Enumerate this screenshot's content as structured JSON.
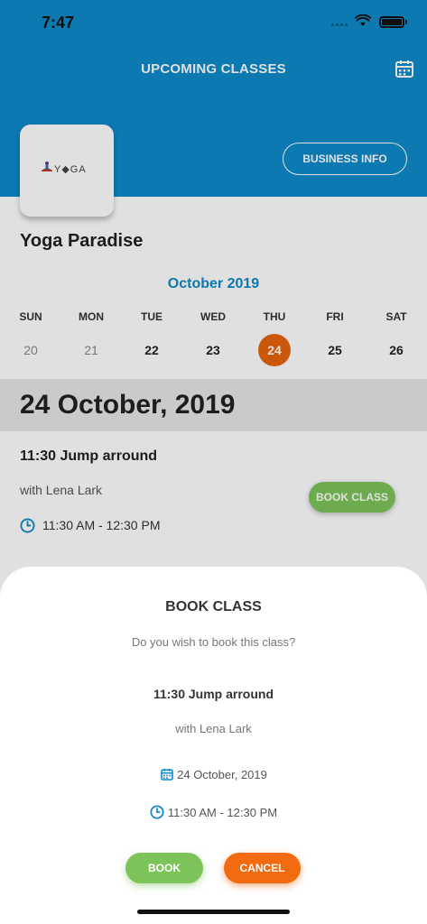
{
  "status_bar": {
    "time": "7:47"
  },
  "header": {
    "title": "UPCOMING CLASSES",
    "calendar_icon": "calendar-icon"
  },
  "business": {
    "logo_text": "Y◆GA",
    "info_button": "BUSINESS INFO",
    "name": "Yoga Paradise"
  },
  "calendar": {
    "month": "October 2019",
    "weekdays": [
      "SUN",
      "MON",
      "TUE",
      "WED",
      "THU",
      "FRI",
      "SAT"
    ],
    "days": [
      "20",
      "21",
      "22",
      "23",
      "24",
      "25",
      "26"
    ],
    "selected_day": "24"
  },
  "date_heading": "24 October, 2019",
  "class": {
    "title": "11:30 Jump arround",
    "instructor": "with Lena Lark",
    "time": "11:30 AM - 12:30 PM",
    "book_button": "BOOK CLASS"
  },
  "sheet": {
    "title": "BOOK CLASS",
    "question": "Do you wish to book this class?",
    "class_title": "11:30 Jump arround",
    "instructor": "with Lena Lark",
    "date": "24 October, 2019",
    "time": "11:30 AM - 12:30 PM",
    "book_button": "BOOK",
    "cancel_button": "CANCEL"
  },
  "colors": {
    "brand_blue": "#0e8ac9",
    "accent_orange": "#e8640c",
    "book_green": "#7cc45a",
    "cancel_orange": "#f26b10"
  }
}
